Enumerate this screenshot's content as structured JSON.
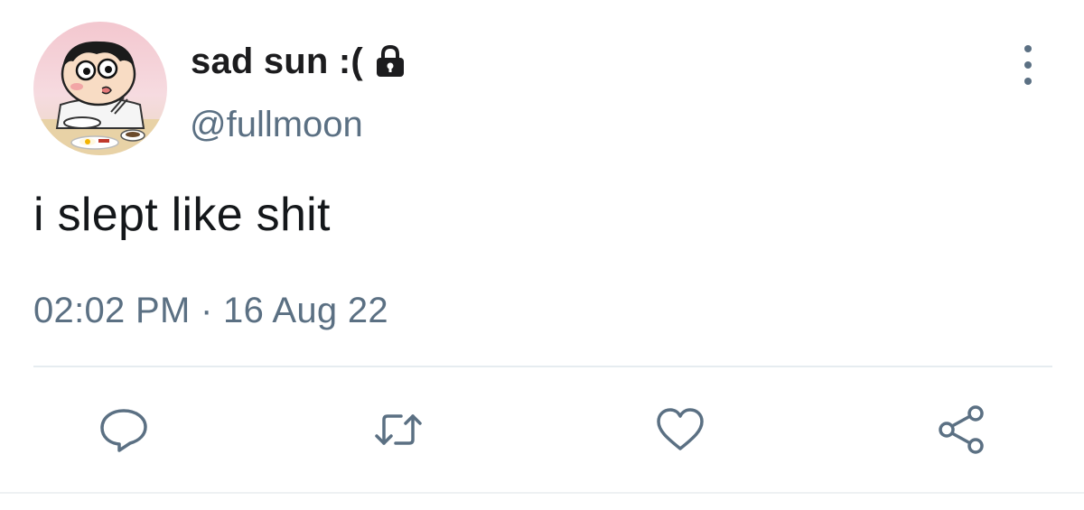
{
  "user": {
    "display_name": "sad sun :(",
    "handle": "@fullmoon",
    "avatar_icon": "cartoon-avatar",
    "protected_icon": "lock-icon"
  },
  "tweet": {
    "text": "i slept like shit",
    "timestamp": "02:02 PM · 16 Aug 22"
  },
  "actions": [
    {
      "name": "reply",
      "icon": "reply-icon"
    },
    {
      "name": "retweet",
      "icon": "retweet-icon"
    },
    {
      "name": "like",
      "icon": "heart-icon"
    },
    {
      "name": "share",
      "icon": "share-icon"
    }
  ],
  "menu": {
    "icon": "more-icon"
  },
  "colors": {
    "text_primary": "#14171a",
    "text_secondary": "#5b7083",
    "divider": "#e6ecf0",
    "background": "#ffffff"
  }
}
